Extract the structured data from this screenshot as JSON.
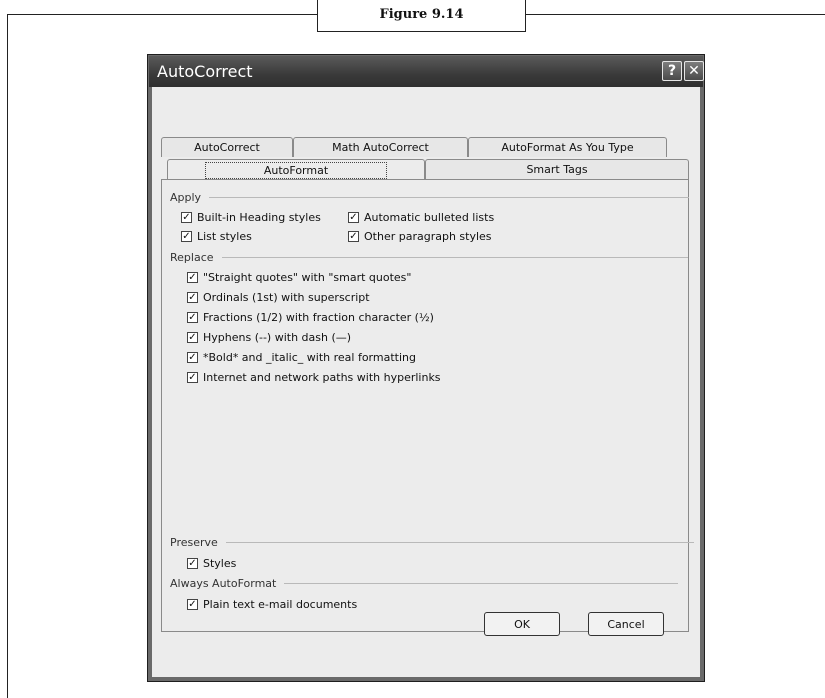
{
  "figure": {
    "caption": "Figure 9.14"
  },
  "window": {
    "title": "AutoCorrect",
    "help_glyph": "?",
    "close_glyph": "✕"
  },
  "tabs_row1": [
    "AutoCorrect",
    "Math AutoCorrect",
    "AutoFormat As You Type"
  ],
  "tabs_row2": [
    "AutoFormat",
    "Smart Tags"
  ],
  "sections": {
    "apply": "Apply",
    "replace": "Replace",
    "preserve": "Preserve",
    "always": "Always AutoFormat"
  },
  "apply_options": [
    {
      "label": "Built-in Heading styles",
      "checked": true
    },
    {
      "label": "Automatic bulleted lists",
      "checked": true
    },
    {
      "label": "List styles",
      "checked": true
    },
    {
      "label": "Other paragraph styles",
      "checked": true
    }
  ],
  "replace_options": [
    {
      "label": "\"Straight quotes\" with \"smart quotes\"",
      "checked": true
    },
    {
      "label": "Ordinals (1st) with superscript",
      "checked": true
    },
    {
      "label": "Fractions (1/2) with fraction character (½)",
      "checked": true
    },
    {
      "label": "Hyphens (--) with dash (—)",
      "checked": true
    },
    {
      "label": "*Bold* and _italic_ with real formatting",
      "checked": true
    },
    {
      "label": "Internet and network paths with hyperlinks",
      "checked": true
    }
  ],
  "preserve_options": [
    {
      "label": "Styles",
      "checked": true
    }
  ],
  "always_options": [
    {
      "label": "Plain text e-mail documents",
      "checked": true
    }
  ],
  "buttons": {
    "ok": "OK",
    "cancel": "Cancel"
  },
  "check_glyph": "✓"
}
